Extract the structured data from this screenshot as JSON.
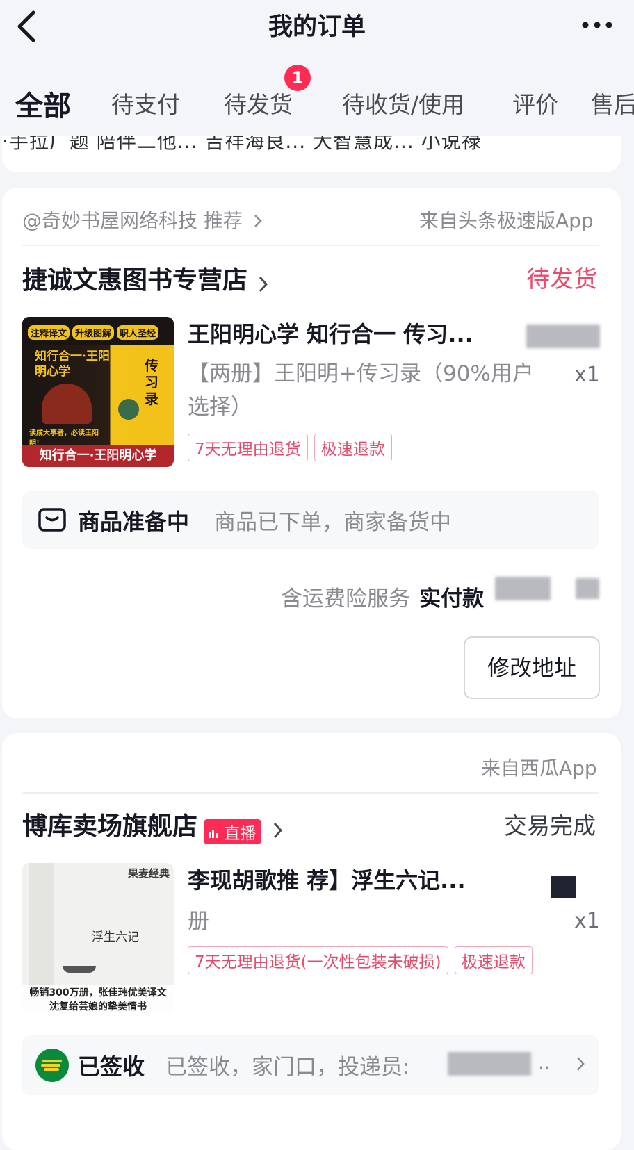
{
  "header": {
    "title": "我的订单"
  },
  "tabs": [
    {
      "label": "全部"
    },
    {
      "label": "待支付"
    },
    {
      "label": "待发货",
      "badge": "1"
    },
    {
      "label": "待收货/使用"
    },
    {
      "label": "评价"
    },
    {
      "label": "售后"
    }
  ],
  "prev_card_strip": "·手拉广题      陪伴二他...      吉祥海良...      大智慧成...      小说禄",
  "orders": [
    {
      "recommend": "@奇妙书屋网络科技 推荐",
      "source": "来自头条极速版App",
      "store": "捷诚文惠图书专营店",
      "status": "待发货",
      "product_title": "王阳明心学 知行合一 传习...",
      "spec": "【两册】王阳明+传习录（90%用户选择）",
      "qty": "x1",
      "tags": [
        "7天无理由退货",
        "极速退款"
      ],
      "cover": {
        "banner_top": [
          "注释译文",
          "升级图解",
          "职人圣经"
        ],
        "book1_title": "知行合一·王阳明心学",
        "book1_slogan": "读成大事者，必读王阳明！",
        "book2_title": "传习录",
        "bottom_banner": "知行合一·王阳明心学"
      },
      "progress_title": "商品准备中",
      "progress_desc": "商品已下单，商家备货中",
      "insurance": "含运费险服务",
      "paid_label": "实付款",
      "action": "修改地址"
    },
    {
      "source": "来自西瓜App",
      "store": "博库卖场旗舰店",
      "live_badge": "直播",
      "status": "交易完成",
      "product_title": "李现胡歌推 荐】浮生六记...",
      "spec": "册",
      "qty": "x1",
      "tags": [
        "7天无理由退货(一次性包装未破损)",
        "极速退款"
      ],
      "cover": {
        "corner": "果麦经典",
        "title": "浮生六记",
        "caption_1": "畅销300万册，张佳玮优美译文",
        "caption_2": "沈复给芸娘的挚美情书"
      },
      "logistics_title": "已签收",
      "logistics_desc": "已签收，家门口，投递员:"
    }
  ],
  "colors": {
    "accent": "#fe2c55",
    "pink_text": "#ea4b6c",
    "page_bg": "#f4f5f8"
  },
  "icons": [
    "back-arrow-icon",
    "more-icon",
    "chevron-right-icon",
    "package-icon",
    "china-post-icon",
    "live-bars-icon"
  ]
}
